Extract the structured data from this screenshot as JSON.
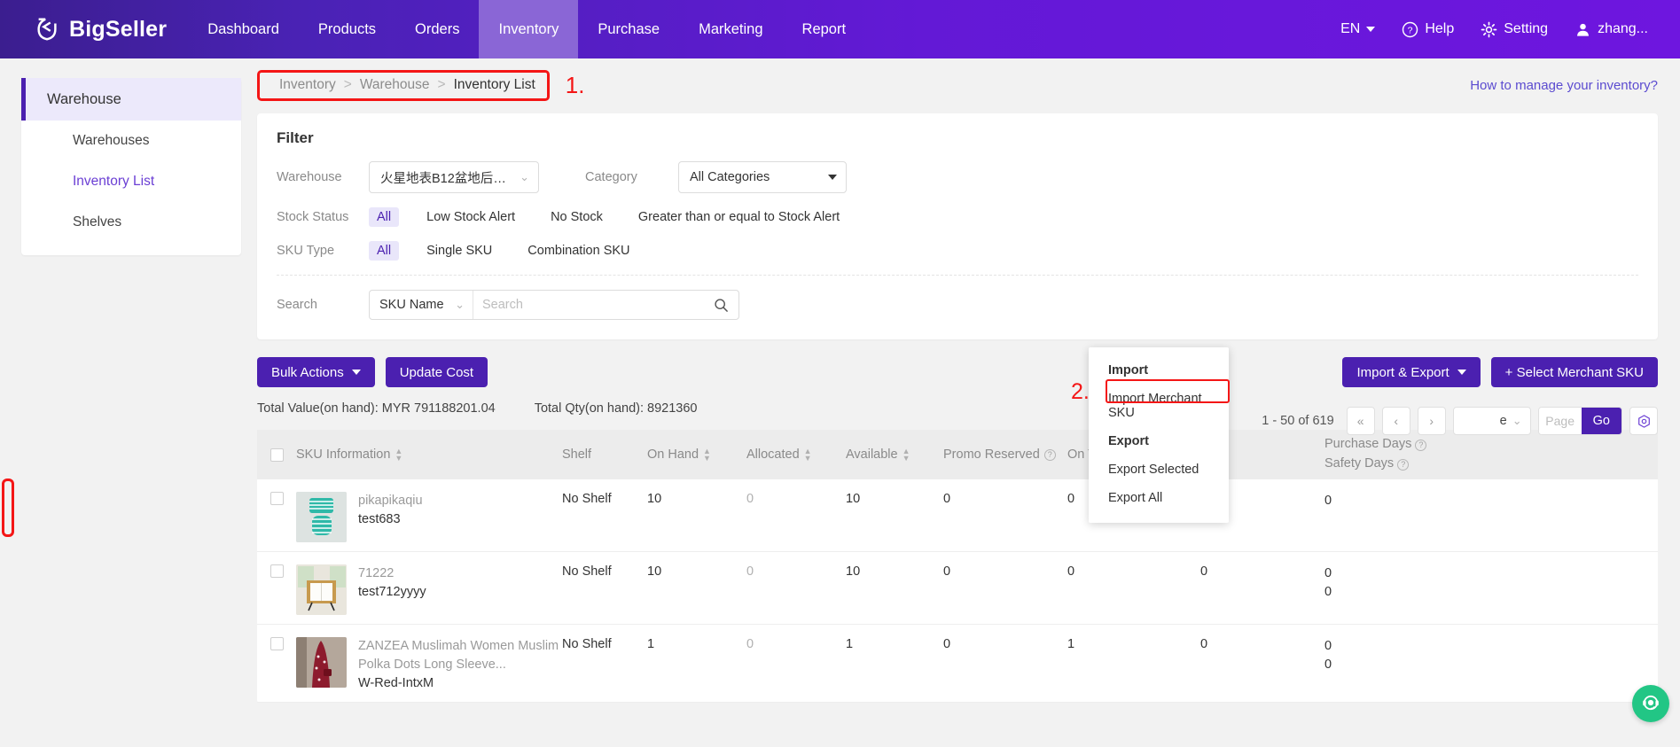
{
  "topnav": {
    "brand": "BigSeller",
    "items": [
      {
        "label": "Dashboard",
        "active": false
      },
      {
        "label": "Products",
        "active": false
      },
      {
        "label": "Orders",
        "active": false
      },
      {
        "label": "Inventory",
        "active": true
      },
      {
        "label": "Purchase",
        "active": false
      },
      {
        "label": "Marketing",
        "active": false
      },
      {
        "label": "Report",
        "active": false
      }
    ],
    "language": "EN",
    "help": "Help",
    "setting": "Setting",
    "account": "zhang..."
  },
  "sidebar": {
    "header": "Warehouse",
    "items": [
      {
        "label": "Warehouses",
        "current": false
      },
      {
        "label": "Inventory List",
        "current": true
      },
      {
        "label": "Shelves",
        "current": false
      }
    ]
  },
  "breadcrumb": {
    "root": "Inventory",
    "sep": ">",
    "mid": "Warehouse",
    "current": "Inventory List",
    "step": "1."
  },
  "howto": "How to manage your inventory?",
  "filter": {
    "title": "Filter",
    "warehouse_label": "Warehouse",
    "warehouse_value": "火星地表B12盆地后勤仓...",
    "category_label": "Category",
    "category_value": "All Categories",
    "stock_status_label": "Stock Status",
    "stock_status_options": [
      {
        "label": "All",
        "selected": true
      },
      {
        "label": "Low Stock Alert",
        "selected": false
      },
      {
        "label": "No Stock",
        "selected": false
      },
      {
        "label": "Greater than or equal to Stock Alert",
        "selected": false
      }
    ],
    "sku_type_label": "SKU Type",
    "sku_type_options": [
      {
        "label": "All",
        "selected": true
      },
      {
        "label": "Single SKU",
        "selected": false
      },
      {
        "label": "Combination SKU",
        "selected": false
      }
    ],
    "search_label": "Search",
    "search_field": "SKU Name",
    "search_placeholder": "Search",
    "search_value": ""
  },
  "toolbar": {
    "bulk_actions": "Bulk Actions",
    "update_cost": "Update Cost",
    "import_export": "Import & Export",
    "select_merchant_sku": "+ Select Merchant SKU"
  },
  "totals": {
    "value": "Total Value(on hand): MYR 791188201.04",
    "qty": "Total Qty(on hand): 8921360"
  },
  "pagination": {
    "range": "1 - 50 of 619",
    "first": "«",
    "prev": "‹",
    "next": "›",
    "page_size": "e",
    "page_placeholder": "Page",
    "go": "Go"
  },
  "dropdown": {
    "import_group": "Import",
    "import_merchant_sku": "Import Merchant SKU",
    "export_group": "Export",
    "export_selected": "Export Selected",
    "export_all": "Export All",
    "step": "2."
  },
  "table": {
    "columns": {
      "sku_information": "SKU Information",
      "shelf": "Shelf",
      "on_hand": "On Hand",
      "allocated": "Allocated",
      "available": "Available",
      "promo_reserved": "Promo Reserved",
      "on_the_way": "On The Way",
      "purchase_days": "Purchase Days",
      "safety_days": "Safety Days"
    },
    "rows": [
      {
        "sku_title": "pikapikaqiu",
        "sku_sub": "test683",
        "shelf": "No Shelf",
        "on_hand": "10",
        "allocated": "0",
        "available": "10",
        "promo_reserved": "0",
        "on_the_way": "0",
        "extra": "",
        "purchase_days": "0",
        "safety_days": ""
      },
      {
        "sku_title": "71222",
        "sku_sub": "test712yyyy",
        "shelf": "No Shelf",
        "on_hand": "10",
        "allocated": "0",
        "available": "10",
        "promo_reserved": "0",
        "on_the_way": "0",
        "extra": "0",
        "purchase_days": "0",
        "safety_days": "0"
      },
      {
        "sku_title": "ZANZEA Muslimah Women Muslim Polka Dots Long Sleeve...",
        "sku_sub": "W-Red-IntxM",
        "shelf": "No Shelf",
        "on_hand": "1",
        "allocated": "0",
        "available": "1",
        "promo_reserved": "0",
        "on_the_way": "1",
        "extra": "0",
        "purchase_days": "0",
        "safety_days": "0"
      }
    ]
  },
  "colors": {
    "brand_purple": "#4b20b0",
    "nav_active": "#8a66d6",
    "accent_link": "#5b4bd0",
    "annotation_red": "#f41616",
    "chat_green": "#22c685"
  }
}
